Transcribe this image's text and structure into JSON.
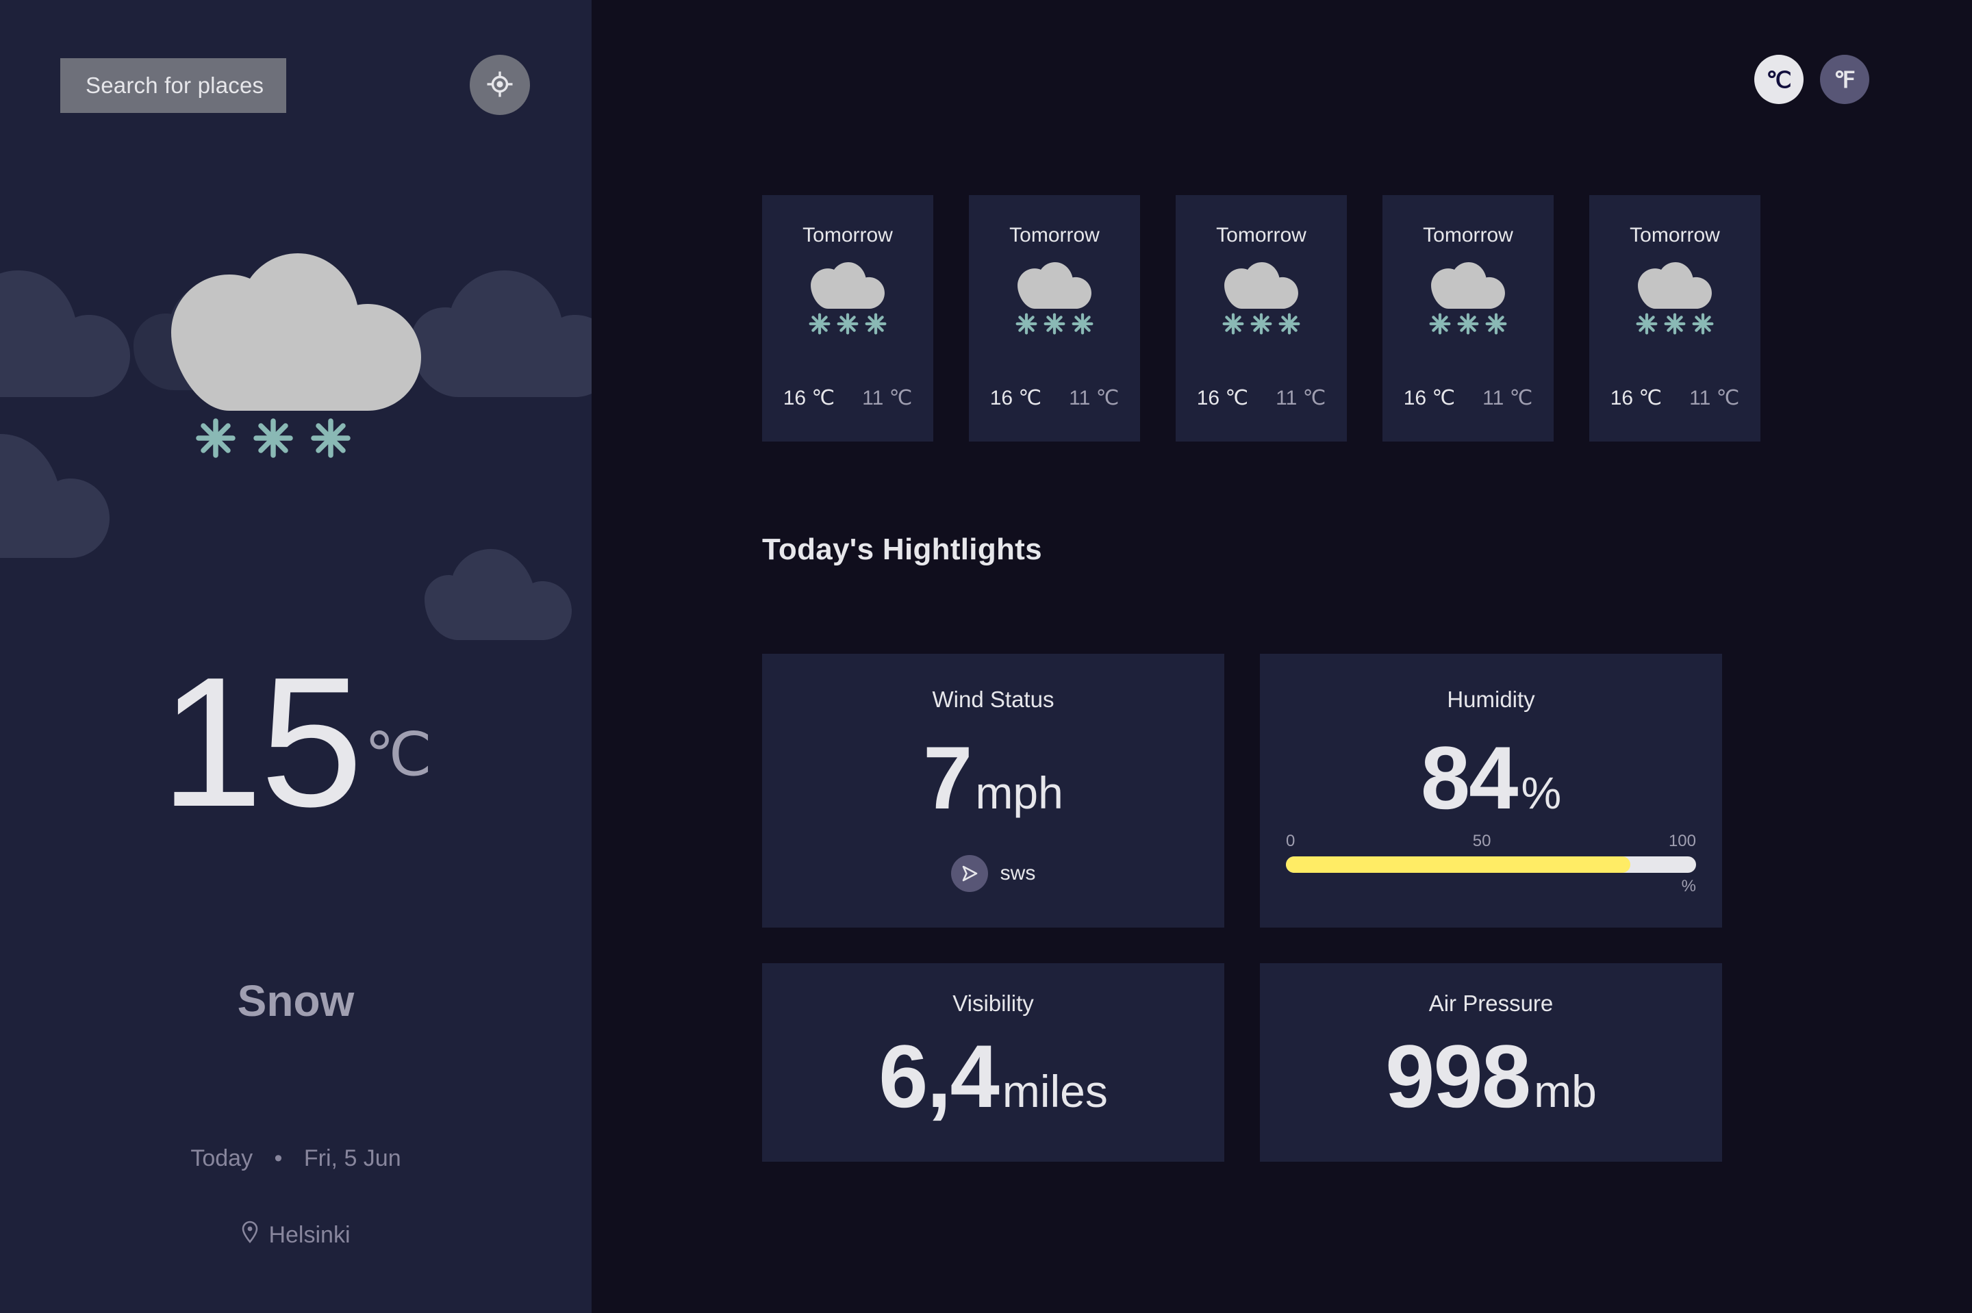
{
  "sidebar": {
    "search_button_label": "Search for places",
    "geo_icon": "crosshair-location-icon",
    "current": {
      "weather_icon": "snow-cloud-icon",
      "temperature": "15",
      "unit": "℃",
      "condition": "Snow",
      "day_label": "Today",
      "separator": "•",
      "date": "Fri, 5 Jun",
      "location_icon": "map-pin-icon",
      "location": "Helsinki"
    }
  },
  "header": {
    "units": [
      {
        "label": "℃",
        "active": true
      },
      {
        "label": "℉",
        "active": false
      }
    ]
  },
  "forecast": {
    "cards": [
      {
        "day": "Tomorrow",
        "icon": "snow-cloud-icon",
        "max": "16 ℃",
        "min": "11 ℃"
      },
      {
        "day": "Tomorrow",
        "icon": "snow-cloud-icon",
        "max": "16 ℃",
        "min": "11 ℃"
      },
      {
        "day": "Tomorrow",
        "icon": "snow-cloud-icon",
        "max": "16 ℃",
        "min": "11 ℃"
      },
      {
        "day": "Tomorrow",
        "icon": "snow-cloud-icon",
        "max": "16 ℃",
        "min": "11 ℃"
      },
      {
        "day": "Tomorrow",
        "icon": "snow-cloud-icon",
        "max": "16 ℃",
        "min": "11 ℃"
      }
    ]
  },
  "highlights": {
    "section_title": "Today's Hightlights",
    "wind": {
      "title": "Wind Status",
      "value": "7",
      "unit": "mph",
      "direction_icon": "navigation-arrow-icon",
      "direction_label": "sws"
    },
    "humidity": {
      "title": "Humidity",
      "value": "84",
      "unit": "%",
      "scale_min": "0",
      "scale_mid": "50",
      "scale_max": "100",
      "bar_suffix": "%",
      "fill_percent": 84
    },
    "visibility": {
      "title": "Visibility",
      "value": "6,4",
      "unit": "miles"
    },
    "pressure": {
      "title": "Air Pressure",
      "value": "998",
      "unit": "mb"
    }
  },
  "colors": {
    "sidebar_bg": "#1E213A",
    "main_bg": "#100E1D",
    "card_bg": "#1E213A",
    "text_primary": "#E7E7EB",
    "text_muted": "#A09FB1",
    "accent_yellow": "#FFEC65",
    "snow_teal": "#8AB9B5",
    "cloud_gray": "#C4C4C4",
    "bg_cloud": "#333751"
  }
}
